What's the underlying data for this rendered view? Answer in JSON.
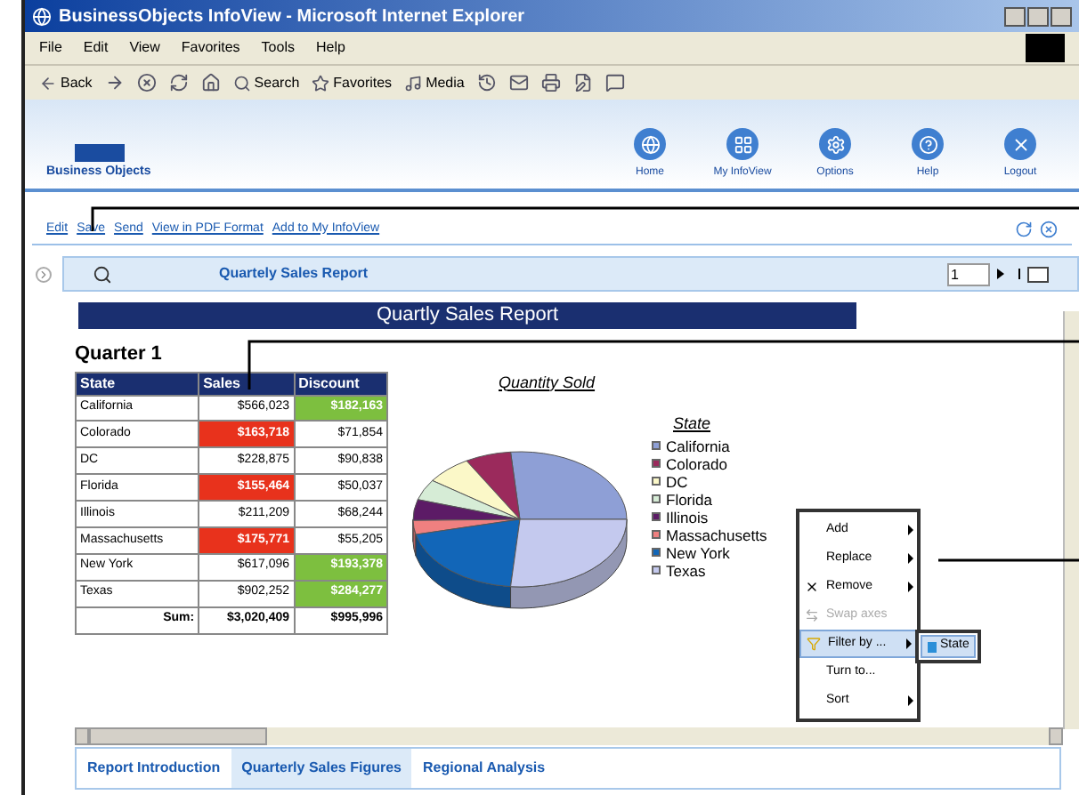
{
  "window": {
    "title": "BusinessObjects InfoView - Microsoft Internet Explorer"
  },
  "menu": [
    "File",
    "Edit",
    "View",
    "Favorites",
    "Tools",
    "Help"
  ],
  "toolbar": [
    {
      "kind": "back",
      "label": "Back"
    },
    {
      "kind": "forward"
    },
    {
      "kind": "stop"
    },
    {
      "kind": "refresh"
    },
    {
      "kind": "home"
    },
    {
      "kind": "search",
      "label": "Search"
    },
    {
      "kind": "favorites",
      "label": "Favorites"
    },
    {
      "kind": "media",
      "label": "Media"
    },
    {
      "kind": "history"
    },
    {
      "kind": "mail"
    },
    {
      "kind": "print"
    },
    {
      "kind": "edit"
    },
    {
      "kind": "discuss"
    }
  ],
  "banner": {
    "logo": "Business Objects",
    "nav": [
      {
        "kind": "home",
        "label": "Home"
      },
      {
        "kind": "infoview",
        "label": "My InfoView"
      },
      {
        "kind": "options",
        "label": "Options"
      },
      {
        "kind": "help",
        "label": "Help"
      },
      {
        "kind": "logout",
        "label": "Logout"
      }
    ]
  },
  "actions": [
    "Edit",
    "Save",
    "Send",
    "View in PDF Format",
    "Add to My InfoView"
  ],
  "report_toolbar": {
    "title": "Quartely Sales Report",
    "page": "1"
  },
  "report": {
    "title": "Quartly Sales Report",
    "section": "Quarter 1",
    "table": {
      "columns": [
        "State",
        "Sales",
        "Discount"
      ],
      "rows": [
        {
          "state": "California",
          "sales": "$566,023",
          "sales_low": false,
          "discount": "$182,163",
          "discount_high": true
        },
        {
          "state": "Colorado",
          "sales": "$163,718",
          "sales_low": true,
          "discount": "$71,854",
          "discount_high": false
        },
        {
          "state": "DC",
          "sales": "$228,875",
          "sales_low": false,
          "discount": "$90,838",
          "discount_high": false
        },
        {
          "state": "Florida",
          "sales": "$155,464",
          "sales_low": true,
          "discount": "$50,037",
          "discount_high": false
        },
        {
          "state": "Illinois",
          "sales": "$211,209",
          "sales_low": false,
          "discount": "$68,244",
          "discount_high": false
        },
        {
          "state": "Massachusetts",
          "sales": "$175,771",
          "sales_low": true,
          "discount": "$55,205",
          "discount_high": false
        },
        {
          "state": "New York",
          "sales": "$617,096",
          "sales_low": false,
          "discount": "$193,378",
          "discount_high": true
        },
        {
          "state": "Texas",
          "sales": "$902,252",
          "sales_low": false,
          "discount": "$284,277",
          "discount_high": true
        }
      ],
      "footer": {
        "label": "Sum:",
        "sales": "$3,020,409",
        "discount": "$995,996"
      }
    },
    "chart": {
      "title": "Quantity Sold",
      "legend_title": "State",
      "legend": [
        {
          "label": "California",
          "color": "#8e9fd6"
        },
        {
          "label": "Colorado",
          "color": "#9b2a5c"
        },
        {
          "label": "DC",
          "color": "#fbf8c8"
        },
        {
          "label": "Florida",
          "color": "#d6ecd6"
        },
        {
          "label": "Illinois",
          "color": "#5c1b66"
        },
        {
          "label": "Massachusetts",
          "color": "#ef8080"
        },
        {
          "label": "New York",
          "color": "#1266b8"
        },
        {
          "label": "Texas",
          "color": "#c4c9ee"
        }
      ]
    }
  },
  "context_menu": {
    "items": [
      {
        "label": "Add",
        "kind": "plain",
        "submenu": true,
        "disabled": false,
        "selected": false
      },
      {
        "label": "Replace",
        "kind": "plain",
        "submenu": true,
        "disabled": false,
        "selected": false
      },
      {
        "label": "Remove",
        "kind": "remove",
        "submenu": true,
        "disabled": false,
        "selected": false
      },
      {
        "label": "Swap axes",
        "kind": "swap",
        "submenu": false,
        "disabled": true,
        "selected": false
      },
      {
        "label": "Filter by ...",
        "kind": "filter",
        "submenu": true,
        "disabled": false,
        "selected": true
      },
      {
        "label": "Turn to...",
        "kind": "plain",
        "submenu": false,
        "disabled": false,
        "selected": false
      },
      {
        "label": "Sort",
        "kind": "plain",
        "submenu": true,
        "disabled": false,
        "selected": false
      }
    ],
    "submenu": [
      "State"
    ]
  },
  "tabs": [
    {
      "label": "Report Introduction",
      "selected": false
    },
    {
      "label": "Quarterly Sales Figures",
      "selected": true
    },
    {
      "label": "Regional Analysis",
      "selected": false
    }
  ]
}
